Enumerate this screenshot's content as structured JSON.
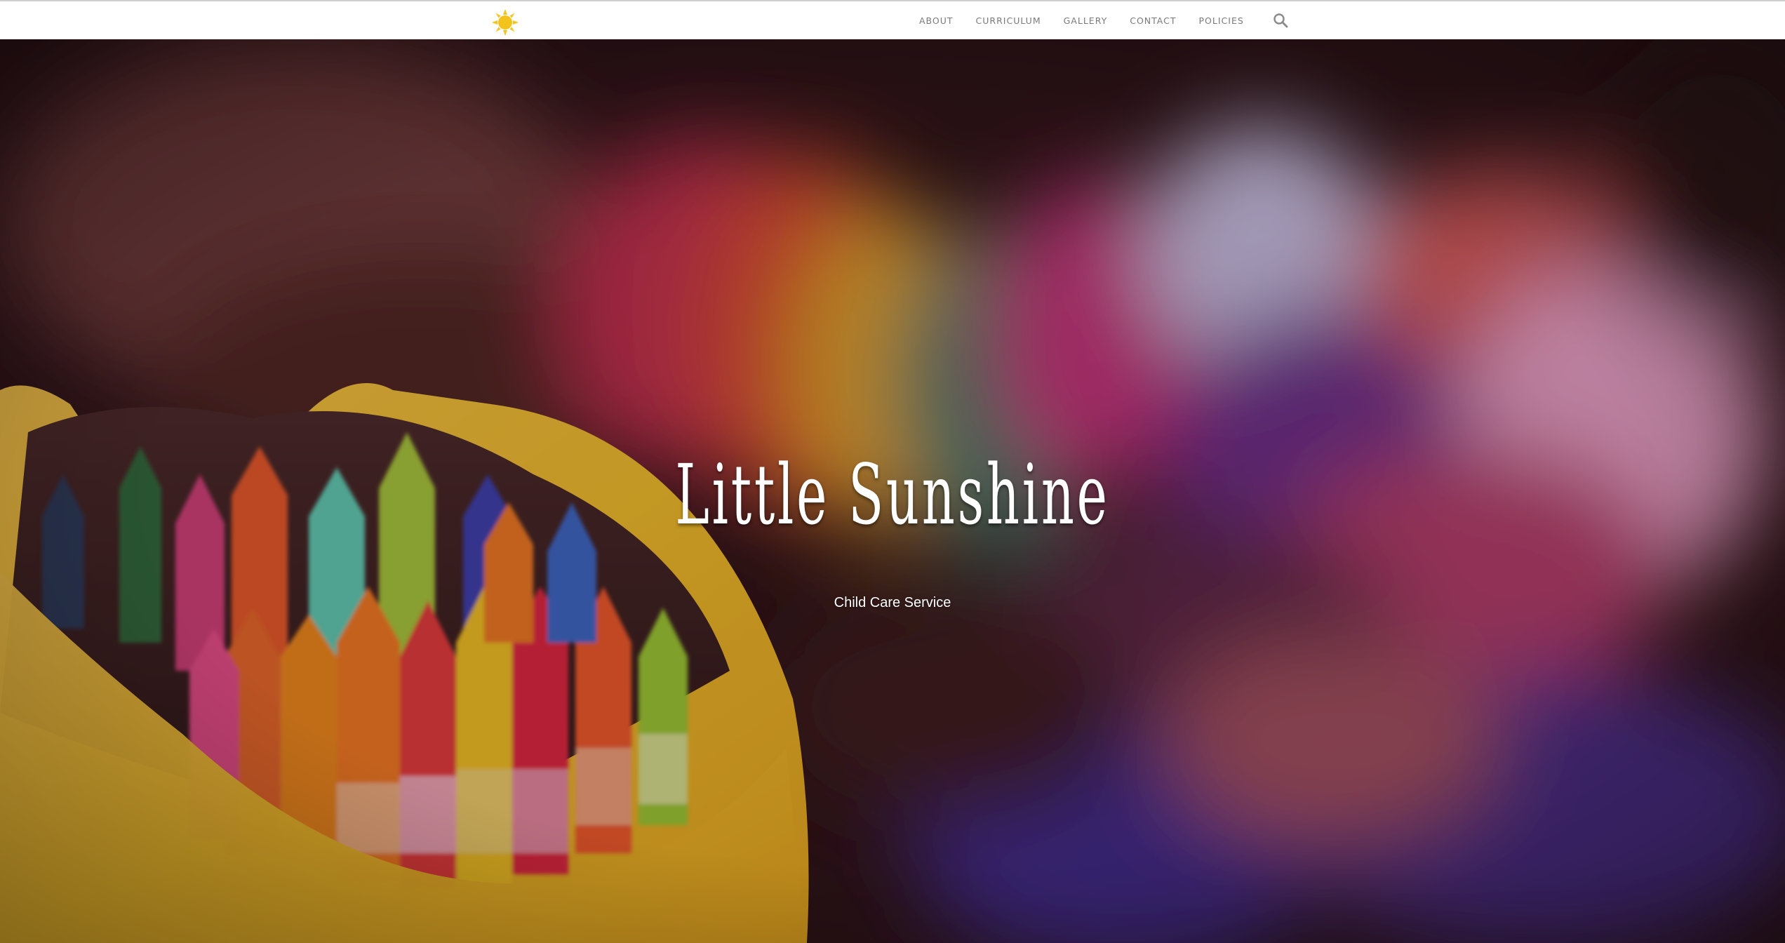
{
  "header": {
    "logo_icon": "sun-icon",
    "nav": [
      {
        "label": "ABOUT"
      },
      {
        "label": "CURRICULUM"
      },
      {
        "label": "GALLERY"
      },
      {
        "label": "CONTACT"
      },
      {
        "label": "POLICIES"
      }
    ],
    "search_icon": "search-icon"
  },
  "hero": {
    "title": "Little Sunshine",
    "subtitle": "Child Care Service",
    "image": "crayons-in-yellow-box"
  },
  "colors": {
    "accent": "#f2c31b",
    "header_bg": "#ffffff",
    "nav_text": "#7a7a7a",
    "hero_text": "#ffffff"
  }
}
